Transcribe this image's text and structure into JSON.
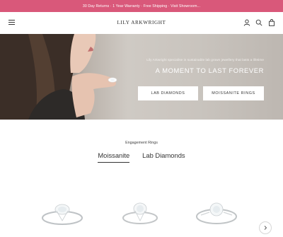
{
  "announcement": "30 Day Returns · 1 Year Warranty · Free Shipping · Visit Showroom...",
  "header": {
    "logo": "LILY ARKWRIGHT"
  },
  "hero": {
    "subtitle": "Lily Arkwright specialise in sustainable lab grown jewellery that lasts a lifetime",
    "title": "A MOMENT TO LAST FOREVER",
    "buttons": [
      "LAB DIAMONDS",
      "MOISSANITE RINGS"
    ]
  },
  "section": {
    "label": "Engagement Rings",
    "tabs": [
      {
        "label": "Moissanite",
        "active": true
      },
      {
        "label": "Lab Diamonds",
        "active": false
      }
    ]
  },
  "colors": {
    "announcement_bg": "#d9587a",
    "text": "#2b2b2b"
  }
}
